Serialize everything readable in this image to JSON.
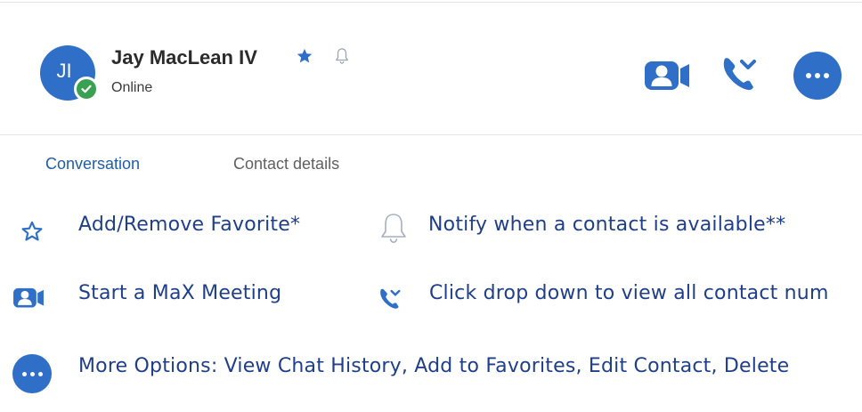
{
  "contact": {
    "initials": "JI",
    "name": "Jay MacLean IV",
    "status": "Online"
  },
  "tabs": [
    {
      "label": "Conversation",
      "active": true
    },
    {
      "label": "Contact details",
      "active": false
    }
  ],
  "legend": {
    "favorite": "Add/Remove Favorite*",
    "notify": "Notify when a contact is available**",
    "meeting": "Start a MaX Meeting",
    "numbers": "Click drop down to view all contact num",
    "more": "More Options:  View Chat History, Add to Favorites, Edit Contact, Delete"
  },
  "colors": {
    "brand_blue": "#2f6fc7",
    "online_green": "#3aa052",
    "legend_text": "#1f3f8a",
    "active_tab": "#1f5fa8"
  },
  "icons": [
    "star-icon",
    "bell-icon",
    "video-meeting-icon",
    "phone-dropdown-icon",
    "more-options-icon",
    "checkmark-icon"
  ]
}
